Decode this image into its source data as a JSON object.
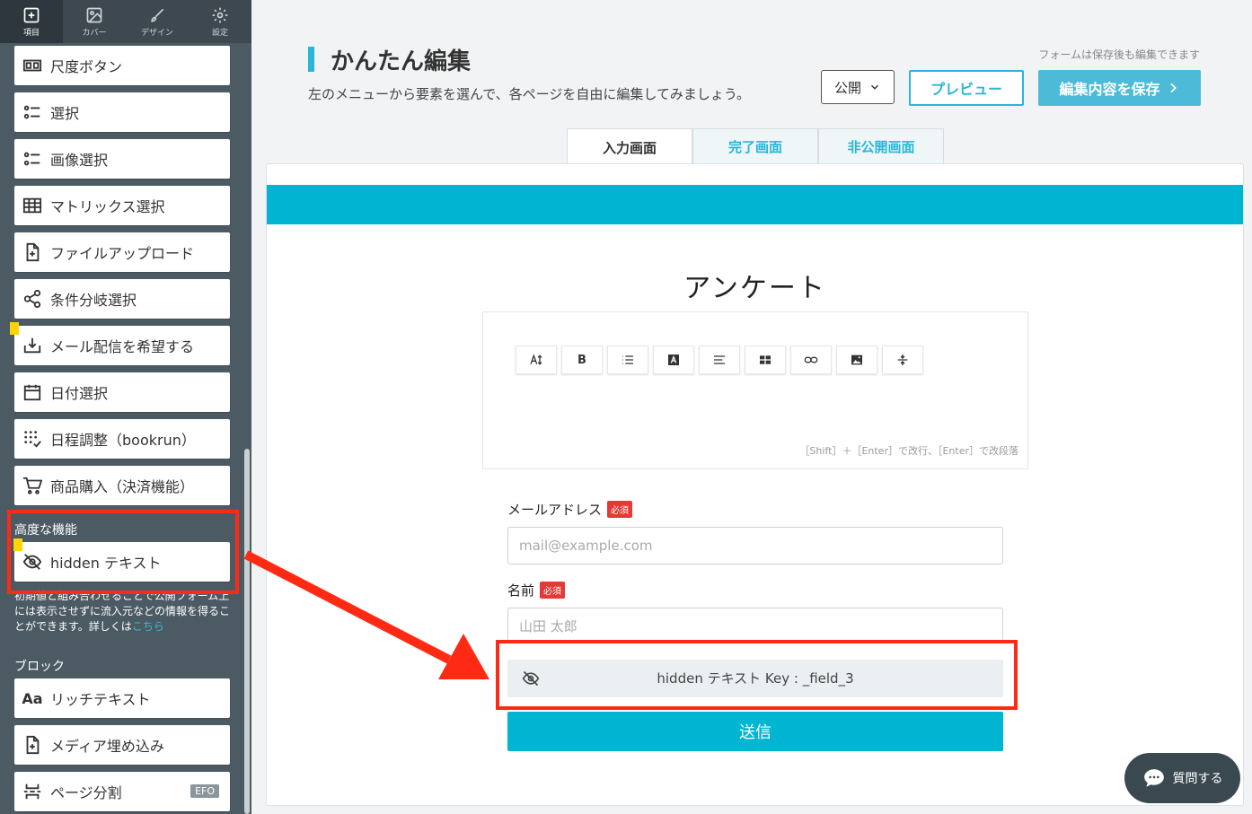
{
  "sidebar": {
    "tabs": [
      {
        "label": "項目",
        "icon": "plus-square-icon"
      },
      {
        "label": "カバー",
        "icon": "image-icon"
      },
      {
        "label": "デザイン",
        "icon": "brush-icon"
      },
      {
        "label": "設定",
        "icon": "gear-icon"
      }
    ],
    "items": [
      {
        "label": "尺度ボタン",
        "icon": "scale-icon"
      },
      {
        "label": "選択",
        "icon": "list-icon"
      },
      {
        "label": "画像選択",
        "icon": "list-icon"
      },
      {
        "label": "マトリックス選択",
        "icon": "table-icon"
      },
      {
        "label": "ファイルアップロード",
        "icon": "file-plus-icon"
      },
      {
        "label": "条件分岐選択",
        "icon": "share-icon"
      },
      {
        "label": "メール配信を希望する",
        "icon": "inbox-download-icon"
      },
      {
        "label": "日付選択",
        "icon": "calendar-icon"
      },
      {
        "label": "日程調整（bookrun）",
        "icon": "dots-grid-icon"
      },
      {
        "label": "商品購入（決済機能）",
        "icon": "cart-icon"
      }
    ],
    "advanced_heading": "高度な機能",
    "hidden_item": {
      "label": "hidden テキスト",
      "icon": "eye-off-icon"
    },
    "description": "初期値と組み合わせることで公開フォーム上には表示させずに流入元などの情報を得ることができます。詳しくは",
    "description_link": "こちら",
    "block_heading": "ブロック",
    "block_items": [
      {
        "label": "リッチテキスト",
        "icon": "text-aa-icon"
      },
      {
        "label": "メディア埋め込み",
        "icon": "file-plus-icon"
      },
      {
        "label": "ページ分割",
        "icon": "page-break-icon",
        "badge": "EFO"
      }
    ]
  },
  "header": {
    "title": "かんたん編集",
    "subtitle": "左のメニューから要素を選んで、各ページを自由に編集してみましょう。",
    "note": "フォームは保存後も編集できます",
    "visibility_select": "公開",
    "preview_label": "プレビュー",
    "save_label": "編集内容を保存"
  },
  "tabs": [
    "入力画面",
    "完了画面",
    "非公開画面"
  ],
  "form": {
    "title": "アンケート",
    "editor_hint": "［Shift］＋［Enter］で改行、［Enter］で改段落",
    "toolbar": [
      "font-size-icon",
      "bold-icon",
      "bullet-list-icon",
      "highlight-icon",
      "align-left-icon",
      "table-icon",
      "link-icon",
      "image-icon",
      "divider-icon"
    ],
    "toolbar_bold_text": "B",
    "fields": [
      {
        "label": "メールアドレス",
        "required": "必須",
        "placeholder": "mail@example.com"
      },
      {
        "label": "名前",
        "required": "必須",
        "placeholder": "山田 太郎"
      }
    ],
    "hidden_field": "hidden テキスト Key : _field_3",
    "submit_label": "送信"
  },
  "chat": {
    "label": "質問する"
  },
  "colors": {
    "accent": "#00b5d1",
    "sidebar": "#4c5a64",
    "highlight": "#ff2a14"
  }
}
